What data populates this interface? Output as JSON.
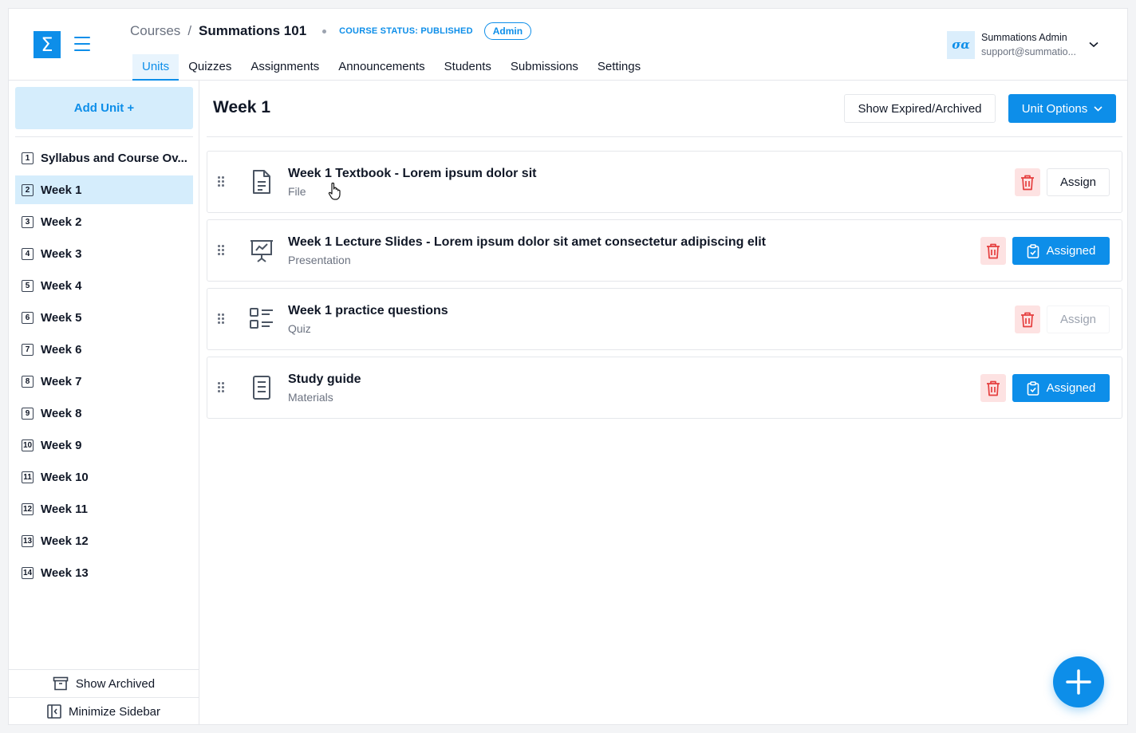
{
  "app": {
    "logo_glyph": "Σ",
    "accent_color": "#0d8ee9",
    "danger_color": "#e53e3e"
  },
  "breadcrumb": {
    "root": "Courses",
    "separator": "/",
    "current": "Summations 101",
    "status": "COURSE STATUS: PUBLISHED",
    "role_badge": "Admin"
  },
  "tabs": [
    {
      "label": "Units",
      "active": true
    },
    {
      "label": "Quizzes",
      "active": false
    },
    {
      "label": "Assignments",
      "active": false
    },
    {
      "label": "Announcements",
      "active": false
    },
    {
      "label": "Students",
      "active": false
    },
    {
      "label": "Submissions",
      "active": false
    },
    {
      "label": "Settings",
      "active": false
    }
  ],
  "user": {
    "avatar_text": "σα",
    "name": "Summations Admin",
    "email": "support@summatio..."
  },
  "sidebar": {
    "add_unit_label": "Add Unit +",
    "units": [
      {
        "num": "1",
        "name": "Syllabus and Course Ov..."
      },
      {
        "num": "2",
        "name": "Week 1",
        "active": true
      },
      {
        "num": "3",
        "name": "Week 2"
      },
      {
        "num": "4",
        "name": "Week 3"
      },
      {
        "num": "5",
        "name": "Week 4"
      },
      {
        "num": "6",
        "name": "Week 5"
      },
      {
        "num": "7",
        "name": "Week 6"
      },
      {
        "num": "8",
        "name": "Week 7"
      },
      {
        "num": "9",
        "name": "Week 8"
      },
      {
        "num": "10",
        "name": "Week 9"
      },
      {
        "num": "11",
        "name": "Week 10"
      },
      {
        "num": "12",
        "name": "Week 11"
      },
      {
        "num": "13",
        "name": "Week 12"
      },
      {
        "num": "14",
        "name": "Week 13"
      }
    ],
    "show_archived_label": "Show Archived",
    "minimize_label": "Minimize Sidebar"
  },
  "main": {
    "title": "Week 1",
    "show_expired_label": "Show Expired/Archived",
    "unit_options_label": "Unit Options",
    "items": [
      {
        "title": "Week 1 Textbook - Lorem ipsum dolor sit",
        "type": "File",
        "icon": "file-text-icon",
        "action": "Assign"
      },
      {
        "title": "Week 1 Lecture Slides - Lorem ipsum dolor sit amet consectetur adipiscing elit",
        "type": "Presentation",
        "icon": "presentation-icon",
        "action": "Assigned"
      },
      {
        "title": "Week 1 practice questions",
        "type": "Quiz",
        "icon": "list-check-icon",
        "action": "Assign"
      },
      {
        "title": "Study guide",
        "type": "Materials",
        "icon": "notes-icon",
        "action": "Assigned"
      }
    ]
  }
}
